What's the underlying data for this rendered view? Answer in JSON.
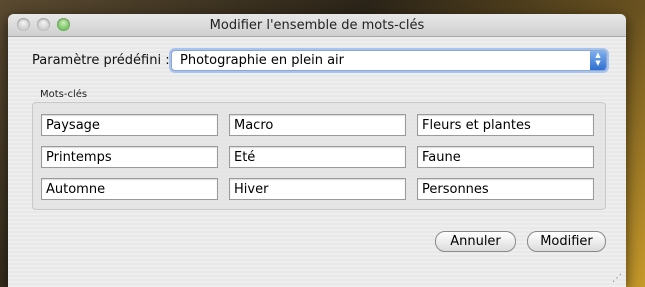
{
  "window": {
    "title": "Modifier l'ensemble de mots-clés"
  },
  "preset": {
    "label": "Paramètre prédéfini :",
    "value": "Photographie en plein air"
  },
  "keywords": {
    "group_label": "Mots-clés",
    "rows": [
      [
        "Paysage",
        "Macro",
        "Fleurs et plantes"
      ],
      [
        "Printemps",
        "Eté",
        "Faune"
      ],
      [
        "Automne",
        "Hiver",
        "Personnes"
      ]
    ]
  },
  "buttons": {
    "cancel": "Annuler",
    "modify": "Modifier"
  }
}
